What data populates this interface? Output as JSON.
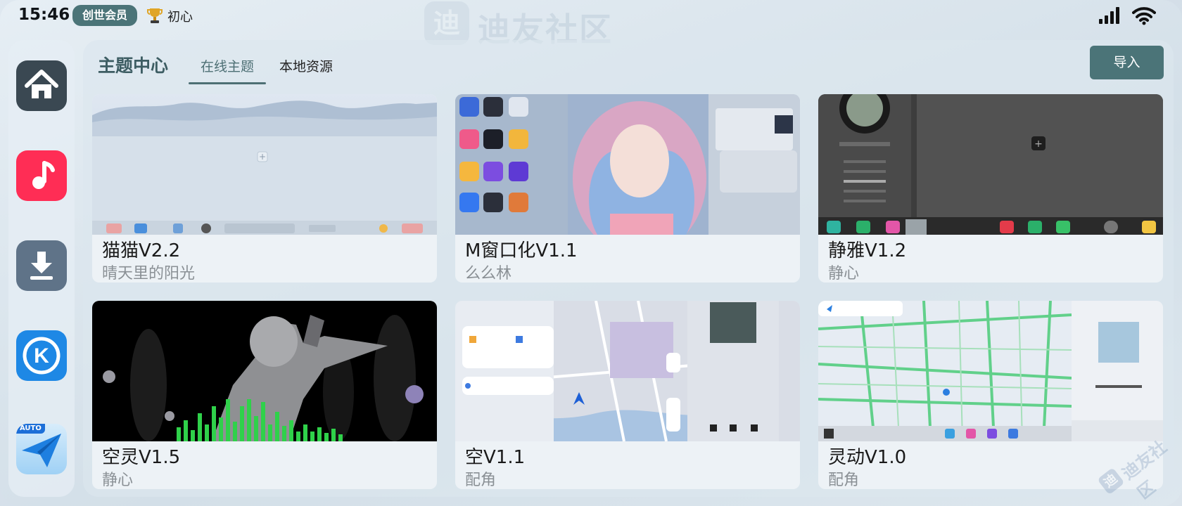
{
  "status_bar": {
    "time": "15:46",
    "member_badge": "创世会员",
    "user_name": "初心",
    "icons": [
      "trophy-icon",
      "signal-icon",
      "wifi-icon"
    ]
  },
  "watermark": {
    "logo_char": "迪",
    "text": "迪友社区"
  },
  "dock": {
    "items": [
      {
        "name": "home",
        "icon": "home-icon"
      },
      {
        "name": "music",
        "icon": "music-note-icon"
      },
      {
        "name": "download",
        "icon": "download-icon"
      },
      {
        "name": "k-app",
        "icon": "k-logo-icon",
        "glyph": "K"
      },
      {
        "name": "auto-navi",
        "icon": "paper-plane-icon",
        "tag": "AUTO"
      }
    ]
  },
  "header": {
    "title": "主题中心",
    "tabs": [
      {
        "label": "在线主题",
        "active": true
      },
      {
        "label": "本地资源",
        "active": false
      }
    ],
    "import_label": "导入"
  },
  "themes": [
    {
      "name": "猫猫V2.2",
      "author": "晴天里的阳光",
      "preview": "misty-mountain-lake"
    },
    {
      "name": "M窗口化V1.1",
      "author": "么么林",
      "preview": "anime-girl-pastel"
    },
    {
      "name": "静雅V1.2",
      "author": "静心",
      "preview": "dark-music-player"
    },
    {
      "name": "空灵V1.5",
      "author": "静心",
      "preview": "dark-anime-visualizer"
    },
    {
      "name": "空V1.1",
      "author": "配角",
      "preview": "map-navigation-music"
    },
    {
      "name": "灵动V1.0",
      "author": "配角",
      "preview": "map-green-roads"
    }
  ],
  "colors": {
    "accent": "#4b7478",
    "title": "#3d5d63",
    "music_red": "#ff2d55",
    "home_dark": "#3a4852"
  }
}
